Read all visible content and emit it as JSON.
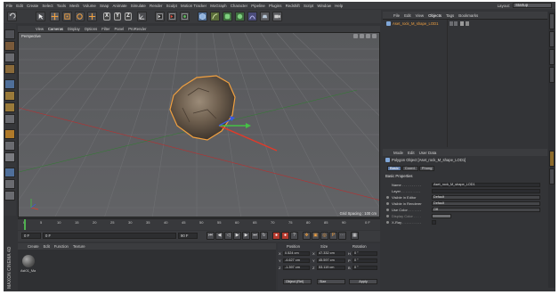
{
  "menubar": {
    "items": [
      "File",
      "Edit",
      "Create",
      "Select",
      "Tools",
      "Mesh",
      "Volume",
      "Snap",
      "Animate",
      "Simulate",
      "Render",
      "Sculpt",
      "Motion Tracker",
      "MoGraph",
      "Character",
      "Pipeline",
      "Plugins",
      "Redshift",
      "Script",
      "Window",
      "Help"
    ],
    "layout_label": "Layout:",
    "layout_value": "Startup"
  },
  "toolbar": {
    "axis_x": "X",
    "axis_y": "Y",
    "axis_z": "Z"
  },
  "viewport": {
    "menu": [
      "View",
      "Cameras",
      "Display",
      "Options",
      "Filter",
      "Panel",
      "ProRender"
    ],
    "label": "Perspective",
    "grid_spacing": "Grid Spacing : 100 cm"
  },
  "timeline": {
    "ticks": [
      "0",
      "5",
      "10",
      "15",
      "20",
      "25",
      "30",
      "35",
      "40",
      "45",
      "50",
      "55",
      "60",
      "65",
      "70",
      "75",
      "80",
      "85",
      "90"
    ],
    "end_label": "0 F",
    "current_frame": "0 F",
    "start_field": "0 F",
    "end_field": "90 F",
    "end_field2": "90 F"
  },
  "materials": {
    "menu": [
      "Create",
      "Edit",
      "Function",
      "Texture"
    ],
    "item_name": "Ast01_Ma",
    "logo": "MAXON CINEMA 4D"
  },
  "coordinates": {
    "headers": [
      "Position",
      "Size",
      "Rotation"
    ],
    "rows": [
      {
        "axis": "X",
        "pos": "0.524 cm",
        "size_axis": "X",
        "size": "47.332 cm",
        "rot_axis": "H",
        "rot": "0 °"
      },
      {
        "axis": "Y",
        "pos": "-4.627 cm",
        "size_axis": "Y",
        "size": "45.597 cm",
        "rot_axis": "P",
        "rot": "0 °"
      },
      {
        "axis": "Z",
        "pos": "-1.397 cm",
        "size_axis": "Z",
        "size": "53.119 cm",
        "rot_axis": "B",
        "rot": "0 °"
      }
    ],
    "mode": "Object (Rel)",
    "size_mode": "Size",
    "apply": "Apply"
  },
  "objects": {
    "menu": [
      "File",
      "Edit",
      "View",
      "Objects",
      "Tags",
      "Bookmarks"
    ],
    "items": [
      {
        "name": "Aset_rock_M_shape_LOD1"
      }
    ]
  },
  "attributes": {
    "menu": [
      "Mode",
      "Edit",
      "User Data"
    ],
    "title": "Polygon Object [Aset_rock_M_shape_LOD1]",
    "tabs": [
      "Basic",
      "Coord.",
      "Phong"
    ],
    "section": "Basic Properties",
    "rows": [
      {
        "label": "Name . . . . . . . . . .",
        "value": "Aset_rock_M_shape_LOD1"
      },
      {
        "label": "Layer . . . . . . . . . .",
        "value": ""
      },
      {
        "label": "Visible in Editor",
        "value": "Default"
      },
      {
        "label": "Visible in Renderer",
        "value": "Default"
      },
      {
        "label": "Use Color . . . . . . .",
        "value": "Off"
      },
      {
        "label": "Display Color . . . .",
        "value": ""
      },
      {
        "label": "X-Ray . . . . . . . . . .",
        "value": ""
      }
    ]
  },
  "colors": {
    "accent_orange": "#f0a040",
    "selected_tab": "#5e7aa6",
    "record_red": "#c24a3a"
  }
}
